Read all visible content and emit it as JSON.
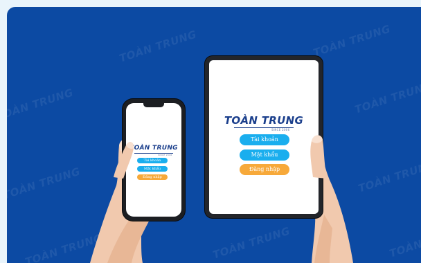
{
  "brand": {
    "name": "TOÀN TRUNG",
    "tagline": "SINCE 2006"
  },
  "watermark": "TOÀN TRUNG",
  "login": {
    "account_label": "Tài khoản",
    "password_label": "Mật khẩu",
    "login_button": "Đăng nhập"
  },
  "colors": {
    "background": "#0c4aa3",
    "accent_blue": "#1aaeee",
    "accent_orange": "#f7a93a",
    "brand": "#1b3f8c"
  }
}
